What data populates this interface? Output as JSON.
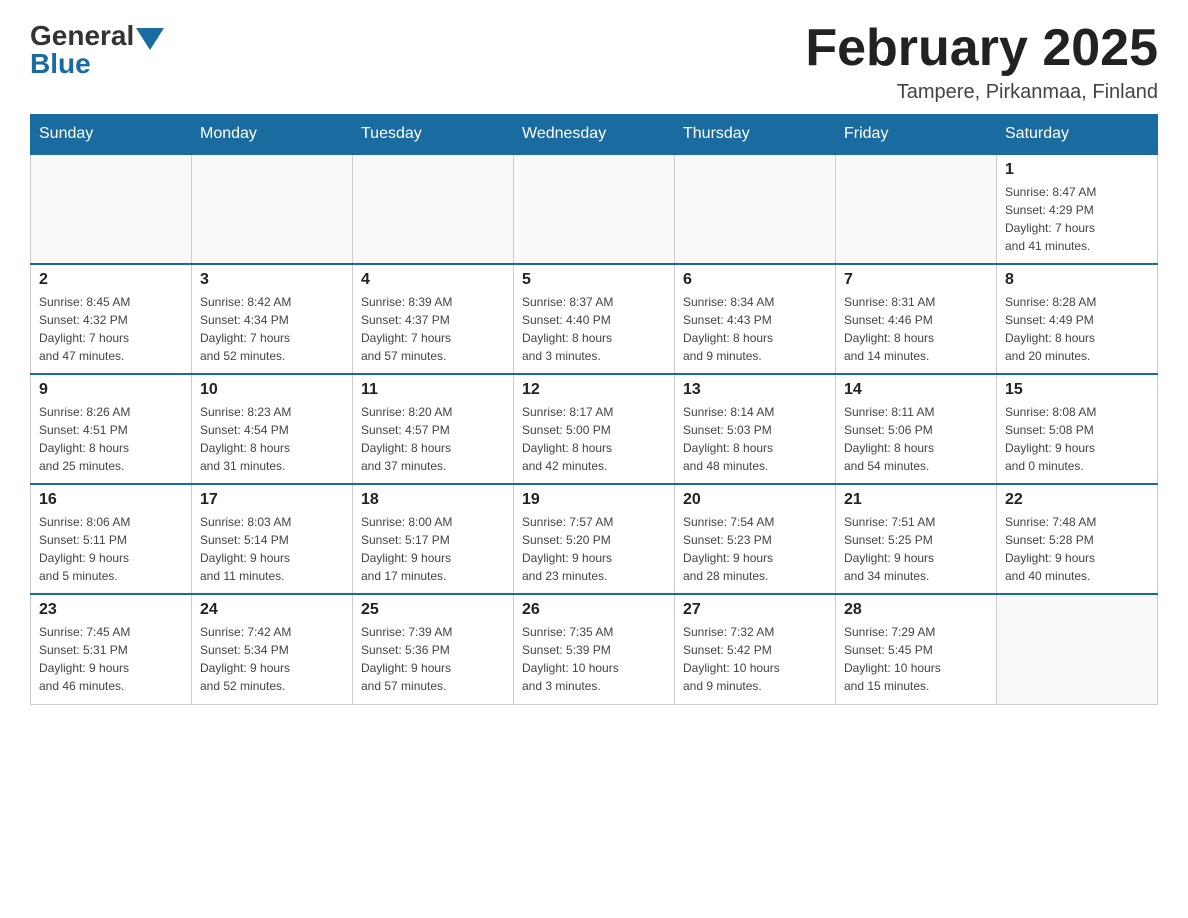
{
  "header": {
    "logo_general": "General",
    "logo_blue": "Blue",
    "month_title": "February 2025",
    "location": "Tampere, Pirkanmaa, Finland"
  },
  "days_of_week": [
    "Sunday",
    "Monday",
    "Tuesday",
    "Wednesday",
    "Thursday",
    "Friday",
    "Saturday"
  ],
  "weeks": [
    [
      {
        "day": "",
        "info": ""
      },
      {
        "day": "",
        "info": ""
      },
      {
        "day": "",
        "info": ""
      },
      {
        "day": "",
        "info": ""
      },
      {
        "day": "",
        "info": ""
      },
      {
        "day": "",
        "info": ""
      },
      {
        "day": "1",
        "info": "Sunrise: 8:47 AM\nSunset: 4:29 PM\nDaylight: 7 hours\nand 41 minutes."
      }
    ],
    [
      {
        "day": "2",
        "info": "Sunrise: 8:45 AM\nSunset: 4:32 PM\nDaylight: 7 hours\nand 47 minutes."
      },
      {
        "day": "3",
        "info": "Sunrise: 8:42 AM\nSunset: 4:34 PM\nDaylight: 7 hours\nand 52 minutes."
      },
      {
        "day": "4",
        "info": "Sunrise: 8:39 AM\nSunset: 4:37 PM\nDaylight: 7 hours\nand 57 minutes."
      },
      {
        "day": "5",
        "info": "Sunrise: 8:37 AM\nSunset: 4:40 PM\nDaylight: 8 hours\nand 3 minutes."
      },
      {
        "day": "6",
        "info": "Sunrise: 8:34 AM\nSunset: 4:43 PM\nDaylight: 8 hours\nand 9 minutes."
      },
      {
        "day": "7",
        "info": "Sunrise: 8:31 AM\nSunset: 4:46 PM\nDaylight: 8 hours\nand 14 minutes."
      },
      {
        "day": "8",
        "info": "Sunrise: 8:28 AM\nSunset: 4:49 PM\nDaylight: 8 hours\nand 20 minutes."
      }
    ],
    [
      {
        "day": "9",
        "info": "Sunrise: 8:26 AM\nSunset: 4:51 PM\nDaylight: 8 hours\nand 25 minutes."
      },
      {
        "day": "10",
        "info": "Sunrise: 8:23 AM\nSunset: 4:54 PM\nDaylight: 8 hours\nand 31 minutes."
      },
      {
        "day": "11",
        "info": "Sunrise: 8:20 AM\nSunset: 4:57 PM\nDaylight: 8 hours\nand 37 minutes."
      },
      {
        "day": "12",
        "info": "Sunrise: 8:17 AM\nSunset: 5:00 PM\nDaylight: 8 hours\nand 42 minutes."
      },
      {
        "day": "13",
        "info": "Sunrise: 8:14 AM\nSunset: 5:03 PM\nDaylight: 8 hours\nand 48 minutes."
      },
      {
        "day": "14",
        "info": "Sunrise: 8:11 AM\nSunset: 5:06 PM\nDaylight: 8 hours\nand 54 minutes."
      },
      {
        "day": "15",
        "info": "Sunrise: 8:08 AM\nSunset: 5:08 PM\nDaylight: 9 hours\nand 0 minutes."
      }
    ],
    [
      {
        "day": "16",
        "info": "Sunrise: 8:06 AM\nSunset: 5:11 PM\nDaylight: 9 hours\nand 5 minutes."
      },
      {
        "day": "17",
        "info": "Sunrise: 8:03 AM\nSunset: 5:14 PM\nDaylight: 9 hours\nand 11 minutes."
      },
      {
        "day": "18",
        "info": "Sunrise: 8:00 AM\nSunset: 5:17 PM\nDaylight: 9 hours\nand 17 minutes."
      },
      {
        "day": "19",
        "info": "Sunrise: 7:57 AM\nSunset: 5:20 PM\nDaylight: 9 hours\nand 23 minutes."
      },
      {
        "day": "20",
        "info": "Sunrise: 7:54 AM\nSunset: 5:23 PM\nDaylight: 9 hours\nand 28 minutes."
      },
      {
        "day": "21",
        "info": "Sunrise: 7:51 AM\nSunset: 5:25 PM\nDaylight: 9 hours\nand 34 minutes."
      },
      {
        "day": "22",
        "info": "Sunrise: 7:48 AM\nSunset: 5:28 PM\nDaylight: 9 hours\nand 40 minutes."
      }
    ],
    [
      {
        "day": "23",
        "info": "Sunrise: 7:45 AM\nSunset: 5:31 PM\nDaylight: 9 hours\nand 46 minutes."
      },
      {
        "day": "24",
        "info": "Sunrise: 7:42 AM\nSunset: 5:34 PM\nDaylight: 9 hours\nand 52 minutes."
      },
      {
        "day": "25",
        "info": "Sunrise: 7:39 AM\nSunset: 5:36 PM\nDaylight: 9 hours\nand 57 minutes."
      },
      {
        "day": "26",
        "info": "Sunrise: 7:35 AM\nSunset: 5:39 PM\nDaylight: 10 hours\nand 3 minutes."
      },
      {
        "day": "27",
        "info": "Sunrise: 7:32 AM\nSunset: 5:42 PM\nDaylight: 10 hours\nand 9 minutes."
      },
      {
        "day": "28",
        "info": "Sunrise: 7:29 AM\nSunset: 5:45 PM\nDaylight: 10 hours\nand 15 minutes."
      },
      {
        "day": "",
        "info": ""
      }
    ]
  ]
}
